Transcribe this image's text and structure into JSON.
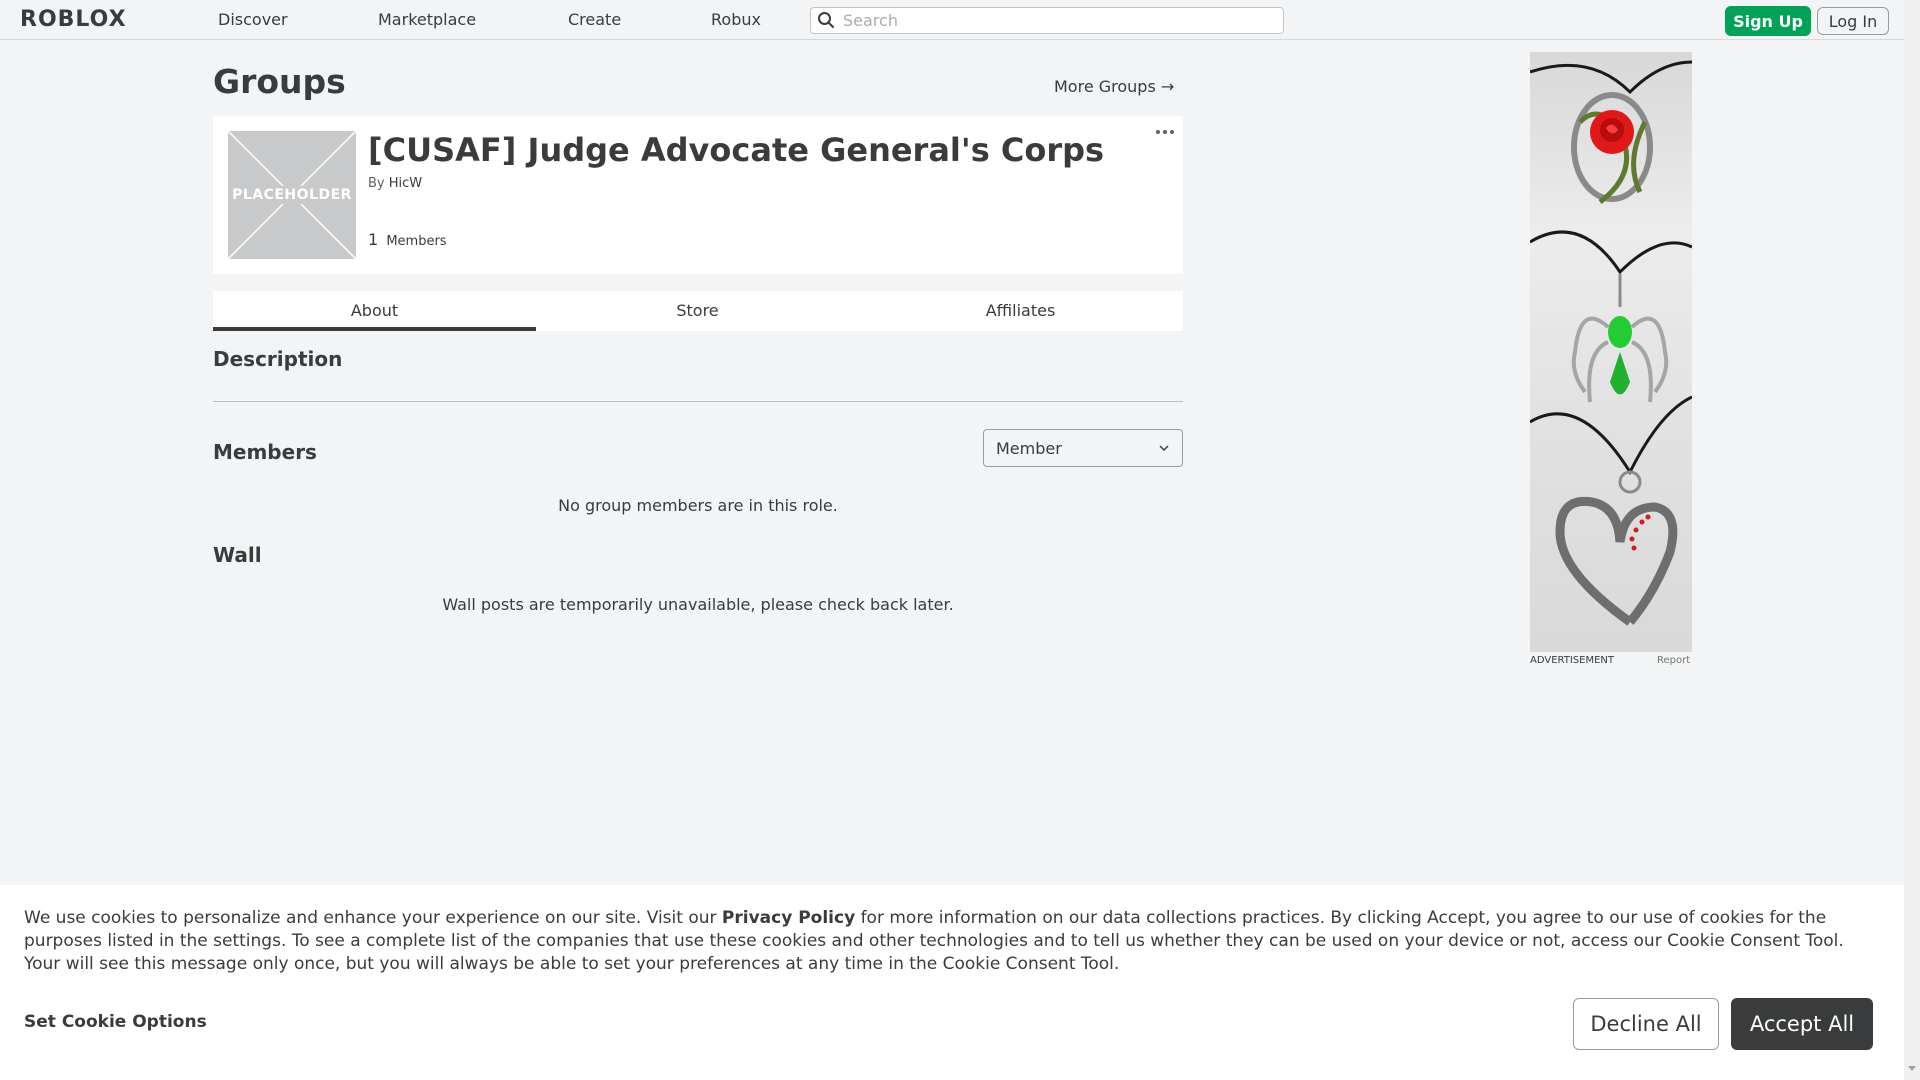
{
  "nav": {
    "logo": "ROBLOX",
    "links": [
      "Discover",
      "Marketplace",
      "Create",
      "Robux"
    ],
    "search_placeholder": "Search",
    "signup_label": "Sign Up",
    "login_label": "Log In"
  },
  "page": {
    "title": "Groups",
    "more_groups": "More Groups →"
  },
  "group": {
    "emblem_text": "PLACEHOLDER",
    "name": "[CUSAF] Judge Advocate General's Corps",
    "by_label": "By",
    "owner": "HicW",
    "member_count": "1",
    "members_label": "Members"
  },
  "tabs": [
    "About",
    "Store",
    "Affiliates"
  ],
  "sections": {
    "description_title": "Description",
    "members_title": "Members",
    "role_select_value": "Member",
    "members_empty": "No group members are in this role.",
    "wall_title": "Wall",
    "wall_empty": "Wall posts are temporarily unavailable, please check back later."
  },
  "ad": {
    "label": "ADVERTISEMENT",
    "report": "Report"
  },
  "cookie": {
    "text_before": "We use cookies to personalize and enhance your experience on our site. Visit our ",
    "policy_link": "Privacy Policy",
    "text_after": " for more information on our data collections practices. By clicking Accept, you agree to our use of cookies for the purposes listed in the settings. To see a complete list of the companies that use these cookies and other technologies and to tell us whether they can be used on your device or not, access our Cookie Consent Tool. Your will see this message only once, but you will always be able to set your preferences at any time in the Cookie Consent Tool.",
    "options_label": "Set Cookie Options",
    "decline_label": "Decline All",
    "accept_label": "Accept All"
  },
  "colors": {
    "signup": "#00a255",
    "accept": "#393b3d",
    "background": "#f2f4f5"
  }
}
